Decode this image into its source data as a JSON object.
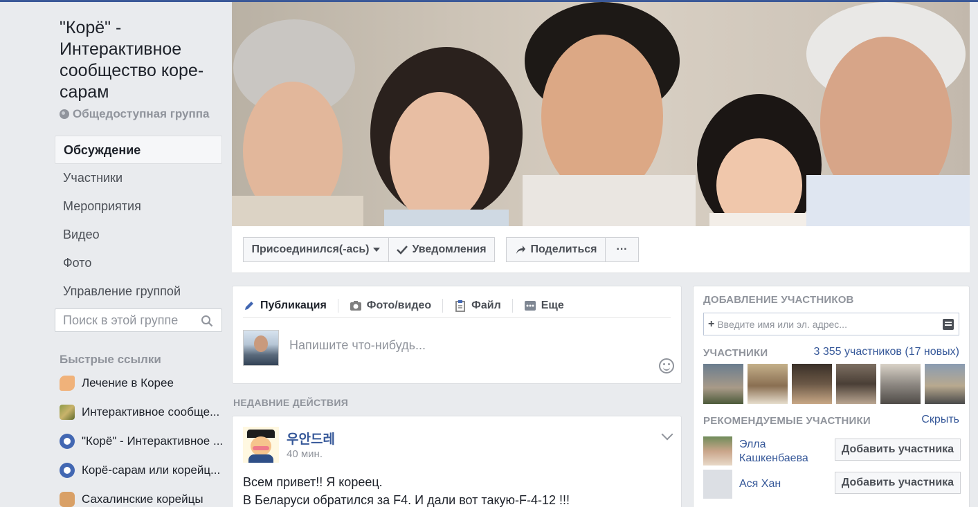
{
  "group": {
    "title": "\"Корё\" - Интерактивное сообщество коре-сарам",
    "type": "Общедоступная группа"
  },
  "nav": {
    "items": [
      {
        "label": "Обсуждение",
        "active": true
      },
      {
        "label": "Участники"
      },
      {
        "label": "Мероприятия"
      },
      {
        "label": "Видео"
      },
      {
        "label": "Фото"
      },
      {
        "label": "Управление группой"
      }
    ],
    "search_placeholder": "Поиск в этой группе"
  },
  "quick_links": {
    "title": "Быстрые ссылки",
    "items": [
      {
        "label": "Лечение в Корее",
        "icon": "pointing-hand-icon"
      },
      {
        "label": "Интерактивное сообще...",
        "icon": "group-photo-icon"
      },
      {
        "label": "\"Корё\" - Интерактивное ...",
        "icon": "group-icon"
      },
      {
        "label": "Корё-сарам или корейц...",
        "icon": "group-icon"
      },
      {
        "label": "Сахалинские корейцы",
        "icon": "fist-icon"
      }
    ]
  },
  "actions": {
    "joined": "Присоединился(-ась)",
    "notifications": "Уведомления",
    "share": "Поделиться",
    "more": "···"
  },
  "composer": {
    "tabs": [
      "Публикация",
      "Фото/видео",
      "Файл",
      "Еще"
    ],
    "placeholder": "Напишите что-нибудь..."
  },
  "recent": {
    "title": "НЕДАВНИЕ ДЕЙСТВИЯ"
  },
  "post": {
    "author": "우안드레",
    "time": "40 мин.",
    "line1": "Всем привет!! Я кореец.",
    "line2": "В Беларуси обратился за F4. И дали вот такую-F-4-12 !!!"
  },
  "right": {
    "add_title": "ДОБАВЛЕНИЕ УЧАСТНИКОВ",
    "add_placeholder": "Введите имя или эл. адрес...",
    "members_title": "УЧАСТНИКИ",
    "members_count": "3 355 участников (17 новых)",
    "suggested_title": "РЕКОМЕНДУЕМЫЕ УЧАСТНИКИ",
    "hide": "Скрыть",
    "add_button": "Добавить участника",
    "suggested": [
      {
        "name": "Элла Кашкенбаева"
      },
      {
        "name": "Ася Хан"
      }
    ]
  },
  "colors": {
    "link": "#365899",
    "brand": "#3b5998",
    "muted": "#90949c"
  }
}
